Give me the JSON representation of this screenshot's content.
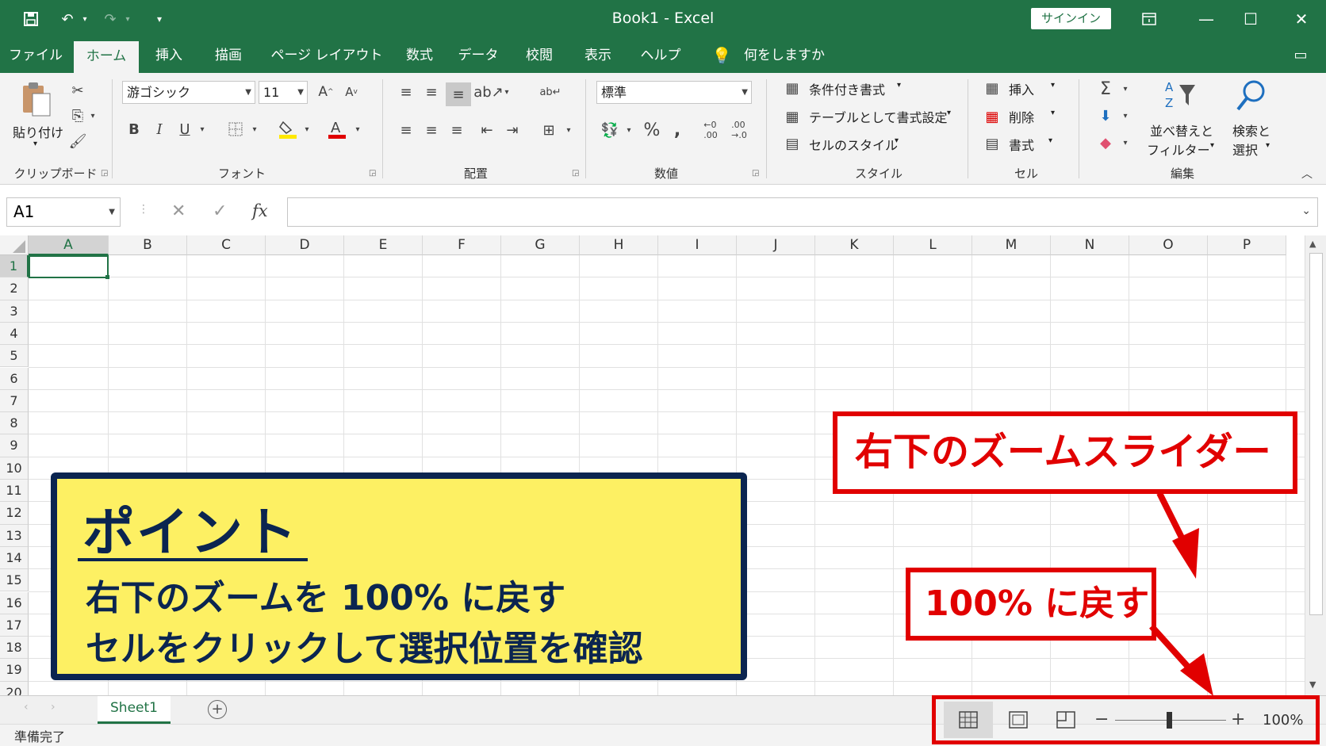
{
  "window": {
    "title": "Book1  -  Excel",
    "signin_label": "サインイン"
  },
  "tabs": [
    "ファイル",
    "ホーム",
    "挿入",
    "描画",
    "ページ レイアウト",
    "数式",
    "データ",
    "校閲",
    "表示",
    "ヘルプ"
  ],
  "tell_me": "何をしますか",
  "ribbon": {
    "clipboard": {
      "paste_label": "貼り付け",
      "group_label": "クリップボード"
    },
    "font": {
      "font_name": "游ゴシック",
      "font_size": "11",
      "group_label": "フォント"
    },
    "alignment": {
      "group_label": "配置"
    },
    "number": {
      "format": "標準",
      "group_label": "数値"
    },
    "styles": {
      "conditional": "条件付き書式",
      "as_table": "テーブルとして書式設定",
      "cell_styles": "セルのスタイル",
      "group_label": "スタイル"
    },
    "cells": {
      "insert": "挿入",
      "delete": "削除",
      "format": "書式",
      "group_label": "セル"
    },
    "editing": {
      "sort_filter_1": "並べ替えと",
      "sort_filter_2": "フィルター",
      "find_select_1": "検索と",
      "find_select_2": "選択",
      "group_label": "編集"
    }
  },
  "formula_bar": {
    "name_box": "A1",
    "fx": "fx"
  },
  "grid": {
    "columns": [
      "A",
      "B",
      "C",
      "D",
      "E",
      "F",
      "G",
      "H",
      "I",
      "J",
      "K",
      "L",
      "M",
      "N",
      "O",
      "P"
    ],
    "rows": [
      "1",
      "2",
      "3",
      "4",
      "5",
      "6",
      "7",
      "8",
      "9",
      "10",
      "11",
      "12",
      "13",
      "14",
      "15",
      "16",
      "17",
      "18",
      "19",
      "20"
    ],
    "selected_cell": "A1"
  },
  "sheets": {
    "active": "Sheet1"
  },
  "status": {
    "text": "準備完了",
    "zoom": "100%"
  },
  "callouts": {
    "point_title": "ポイント",
    "point_line1": "右下のズームを 100% に戻す",
    "point_line2": "セルをクリックして選択位置を確認",
    "slider_note": "右下のズームスライダー",
    "reset_note": "100% に戻す"
  },
  "colors": {
    "excel_green": "#217346",
    "callout_red": "#e10000",
    "callout_yellow": "#fdf063",
    "callout_navy": "#0b2550"
  }
}
